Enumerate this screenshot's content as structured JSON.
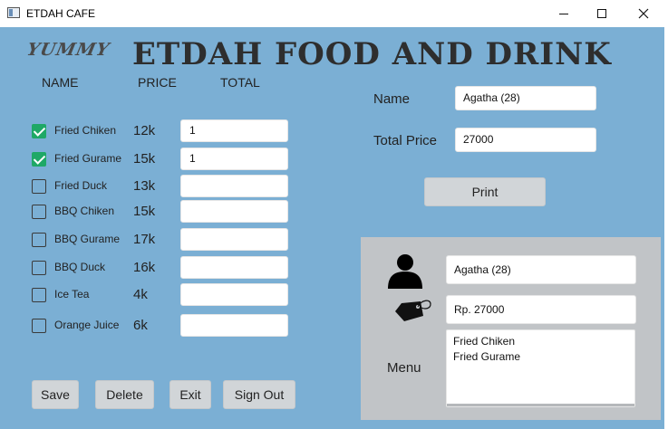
{
  "window": {
    "title": "ETDAH CAFE",
    "controls": [
      "minimize",
      "maximize",
      "close"
    ]
  },
  "header": {
    "logo_text": "YUMMY",
    "title": "ETDAH FOOD AND DRINK"
  },
  "columns": {
    "name": "NAME",
    "price": "PRICE",
    "total": "TOTAL"
  },
  "menu_items": [
    {
      "name": "Fried Chiken",
      "price": "12k",
      "checked": true,
      "qty": "1"
    },
    {
      "name": "Fried Gurame",
      "price": "15k",
      "checked": true,
      "qty": "1"
    },
    {
      "name": "Fried Duck",
      "price": "13k",
      "checked": false,
      "qty": ""
    },
    {
      "name": "BBQ Chiken",
      "price": "15k",
      "checked": false,
      "qty": ""
    },
    {
      "name": "BBQ Gurame",
      "price": "17k",
      "checked": false,
      "qty": ""
    },
    {
      "name": "BBQ Duck",
      "price": "16k",
      "checked": false,
      "qty": ""
    },
    {
      "name": "Ice Tea",
      "price": "4k",
      "checked": false,
      "qty": ""
    },
    {
      "name": "Orange Juice",
      "price": "6k",
      "checked": false,
      "qty": ""
    }
  ],
  "form": {
    "name_label": "Name",
    "name_value": "Agatha (28)",
    "total_label": "Total Price",
    "total_value": "27000",
    "print_label": "Print"
  },
  "receipt": {
    "customer_value": "Agatha (28)",
    "price_value": "Rp. 27000",
    "menu_label": "Menu",
    "menu_lines": [
      "Fried Chiken",
      "Fried Gurame"
    ]
  },
  "actions": {
    "save": "Save",
    "delete": "Delete",
    "exit": "Exit",
    "sign_out": "Sign Out"
  },
  "colors": {
    "background": "#7bafd4",
    "panel": "#c1c4c7",
    "checkbox_checked": "#1fa866",
    "button": "#d1d5d8"
  }
}
